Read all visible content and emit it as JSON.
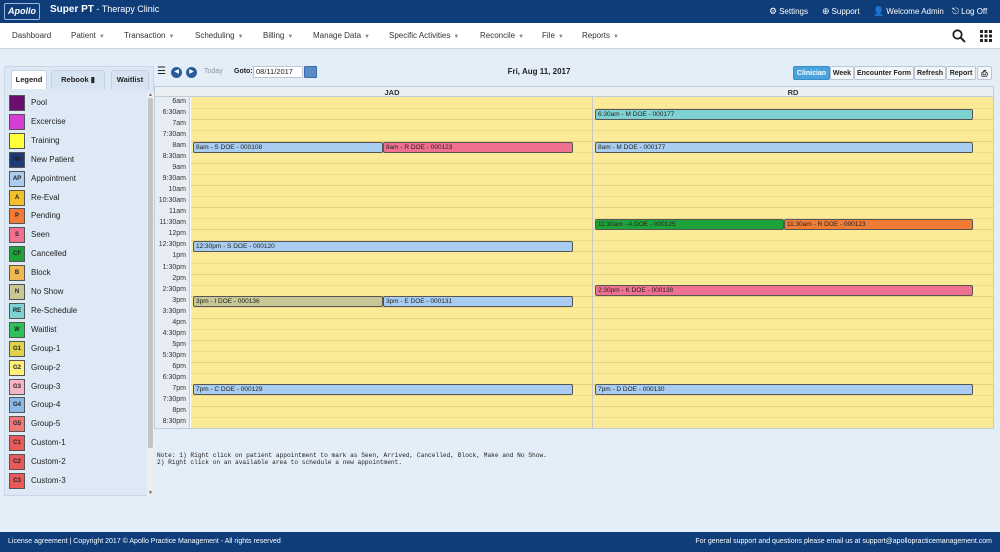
{
  "app": {
    "logo_text": "Apollo",
    "title": "Super PT",
    "subtitle": " - Therapy Clinic"
  },
  "top_links": [
    {
      "label": "Settings",
      "icon": "gear-icon"
    },
    {
      "label": "Support",
      "icon": "plus-circle-icon"
    },
    {
      "label": "Welcome Admin",
      "icon": "user-icon"
    },
    {
      "label": "Log Off",
      "icon": "logout-icon"
    }
  ],
  "nav": [
    {
      "label": "Dashboard"
    },
    {
      "label": "Patient"
    },
    {
      "label": "Transaction"
    },
    {
      "label": "Scheduling"
    },
    {
      "label": "Billing"
    },
    {
      "label": "Manage Data"
    },
    {
      "label": "Specific Activities"
    },
    {
      "label": "Reconcile"
    },
    {
      "label": "File"
    },
    {
      "label": "Reports"
    }
  ],
  "left_tabs": {
    "legend": "Legend",
    "rebook": "Rebook",
    "waitlist": "Waitlist"
  },
  "legend": [
    {
      "code": "",
      "label": "Pool",
      "color": "#6b0f6f"
    },
    {
      "code": "",
      "label": "Excercise",
      "color": "#d43ed4"
    },
    {
      "code": "",
      "label": "Training",
      "color": "#ffff3a"
    },
    {
      "code": "NP",
      "label": "New Patient",
      "color": "#1f3a78"
    },
    {
      "code": "AP",
      "label": "Appointment",
      "color": "#a8cdf0"
    },
    {
      "code": "A",
      "label": "Re-Eval",
      "color": "#f2c02a"
    },
    {
      "code": "P",
      "label": "Pending",
      "color": "#f07c36"
    },
    {
      "code": "S",
      "label": "Seen",
      "color": "#f07090"
    },
    {
      "code": "CF",
      "label": "Cancelled",
      "color": "#1ea33a"
    },
    {
      "code": "B",
      "label": "Block",
      "color": "#f0b850"
    },
    {
      "code": "N",
      "label": "No Show",
      "color": "#c8c896"
    },
    {
      "code": "RE",
      "label": "Re-Schedule",
      "color": "#7ed2d2"
    },
    {
      "code": "W",
      "label": "Waitlist",
      "color": "#2ec05a"
    },
    {
      "code": "G1",
      "label": "Group-1",
      "color": "#e0d24a"
    },
    {
      "code": "G2",
      "label": "Group-2",
      "color": "#fff07a"
    },
    {
      "code": "G3",
      "label": "Group-3",
      "color": "#f6b6c6"
    },
    {
      "code": "G4",
      "label": "Group-4",
      "color": "#8ab8e8"
    },
    {
      "code": "G5",
      "label": "Group-5",
      "color": "#f07878"
    },
    {
      "code": "C1",
      "label": "Custom-1",
      "color": "#e85a5a"
    },
    {
      "code": "C2",
      "label": "Custom-2",
      "color": "#e85a5a"
    },
    {
      "code": "C3",
      "label": "Custom-3",
      "color": "#e85a5a"
    }
  ],
  "toolbar": {
    "today": "Today",
    "goto_label": "Goto:",
    "goto_value": "08/11/2017",
    "date_title": "Fri, Aug 11, 2017",
    "buttons": [
      "Clinician",
      "Week",
      "Encounter Form",
      "Refresh",
      "Report"
    ]
  },
  "columns": [
    "JAD",
    "RD"
  ],
  "times": [
    "6am",
    "6:30am",
    "7am",
    "7:30am",
    "8am",
    "8:30am",
    "9am",
    "9:30am",
    "10am",
    "10:30am",
    "11am",
    "11:30am",
    "12pm",
    "12:30pm",
    "1pm",
    "1:30pm",
    "2pm",
    "2:30pm",
    "3pm",
    "3:30pm",
    "4pm",
    "4:30pm",
    "5pm",
    "5:30pm",
    "6pm",
    "6:30pm",
    "7pm",
    "7:30pm",
    "8pm",
    "8:30pm"
  ],
  "appointments": [
    {
      "column": 0,
      "slot": 4,
      "half": 0,
      "text": "8am - S DOE - 000108",
      "color": "#a8cdf0"
    },
    {
      "column": 0,
      "slot": 4,
      "half": 1,
      "text": "8am - R DOE - 000123",
      "color": "#f07090"
    },
    {
      "column": 0,
      "slot": 13,
      "half": -1,
      "text": "12:30pm - S DOE - 000120",
      "color": "#a8cdf0"
    },
    {
      "column": 0,
      "slot": 18,
      "half": 0,
      "text": "3pm - I DOE - 000136",
      "color": "#c8c896"
    },
    {
      "column": 0,
      "slot": 18,
      "half": 1,
      "text": "3pm - E DOE - 000131",
      "color": "#a8cdf0"
    },
    {
      "column": 0,
      "slot": 26,
      "half": -1,
      "text": "7pm - C DOE - 000129",
      "color": "#a8cdf0"
    },
    {
      "column": 1,
      "slot": 1,
      "half": -1,
      "text": "6:30am - M DOE - 000177",
      "color": "#7ed2d2"
    },
    {
      "column": 1,
      "slot": 4,
      "half": -1,
      "text": "8am - M DOE - 000177",
      "color": "#a8cdf0"
    },
    {
      "column": 1,
      "slot": 11,
      "half": 0,
      "text": "11:30am - A DOE - 000125",
      "color": "#1ea33a"
    },
    {
      "column": 1,
      "slot": 11,
      "half": 1,
      "text": "11:30am - R DOE - 000123",
      "color": "#f07c36"
    },
    {
      "column": 1,
      "slot": 17,
      "half": -1,
      "text": "2:30pm - K DOE - 000138",
      "color": "#f07090"
    },
    {
      "column": 1,
      "slot": 26,
      "half": -1,
      "text": "7pm - D DOE - 000130",
      "color": "#a8cdf0"
    }
  ],
  "notes": [
    "Note: 1) Right click on patient appointment to mark as Seen, Arrived, Cancelled, Block, Make and No Show.",
    "2) Right click on an available area to schedule a new appointment."
  ],
  "footer": {
    "left": "License agreement | Copyright 2017 © Apollo Practice Management - All rights reserved",
    "right": "For general support and questions please email us at support@apollopracticemanagement.com"
  }
}
